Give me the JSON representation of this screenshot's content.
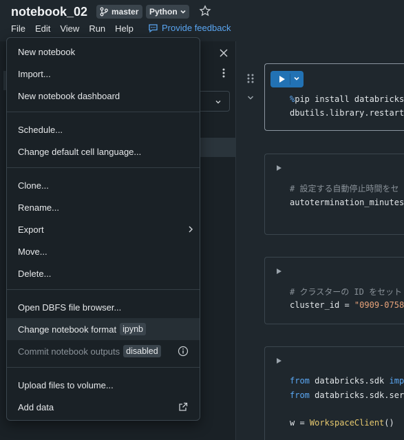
{
  "header": {
    "notebook_title": "notebook_02",
    "branch": "master",
    "language": "Python",
    "feedback_label": "Provide feedback",
    "menubar": [
      "File",
      "Edit",
      "View",
      "Run",
      "Help"
    ]
  },
  "file_menu": {
    "items": [
      {
        "label": "New notebook"
      },
      {
        "label": "Import..."
      },
      {
        "label": "New notebook dashboard"
      },
      {
        "label": "Schedule..."
      },
      {
        "label": "Change default cell language..."
      },
      {
        "label": "Clone..."
      },
      {
        "label": "Rename..."
      },
      {
        "label": "Export"
      },
      {
        "label": "Move..."
      },
      {
        "label": "Delete..."
      },
      {
        "label": "Open DBFS file browser..."
      },
      {
        "label": "Change notebook format",
        "badge": "ipynb"
      },
      {
        "label": "Commit notebook outputs",
        "badge": "disabled"
      },
      {
        "label": "Upload files to volume..."
      },
      {
        "label": "Add data"
      }
    ]
  },
  "cells": {
    "cell1": {
      "line1_pct": "%",
      "line1_rest": "pip install databricks",
      "line2": "dbutils.library.restart"
    },
    "cell2": {
      "comment": "# 設定する自動停止時間をセ",
      "code": "autotermination_minutes"
    },
    "cell3": {
      "comment": "# クラスターの ID をセット",
      "code_var": "cluster_id = ",
      "code_str": "\"0909-07584"
    },
    "cell4": {
      "line1_kw": "from",
      "line1_mid": " databricks.sdk ",
      "line1_kw2": "impo",
      "line2_kw": "from",
      "line2_mid": " databricks.sdk.serv",
      "line3_var": "w = ",
      "line3_fn": "WorkspaceClient",
      "line3_end": "()"
    }
  },
  "colors": {
    "accent": "#2272b4",
    "link": "#5aa6f2",
    "background": "#1f272d"
  }
}
